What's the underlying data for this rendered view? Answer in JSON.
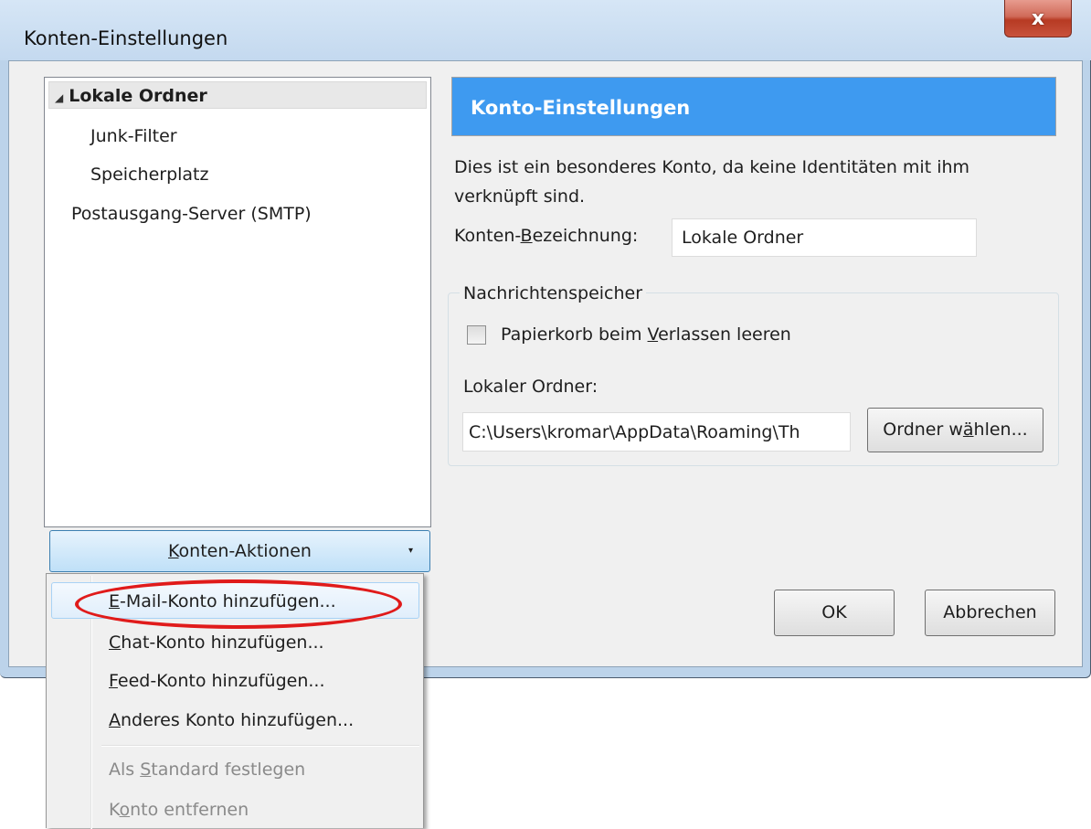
{
  "window": {
    "title": "Konten-Einstellungen",
    "close_symbol": "x"
  },
  "tree": {
    "items": [
      {
        "label": "Lokale Ordner",
        "expander": "◢"
      },
      {
        "label": "Junk-Filter"
      },
      {
        "label": "Speicherplatz"
      },
      {
        "label": "Postausgang-Server (SMTP)"
      }
    ]
  },
  "account_actions": {
    "button": {
      "before": "",
      "accel": "K",
      "after": "onten-Aktionen",
      "drop_symbol": "▾"
    },
    "menu": {
      "items": [
        {
          "accel": "E",
          "after": "-Mail-Konto hinzufügen...",
          "before": ""
        },
        {
          "accel": "C",
          "after": "hat-Konto hinzufügen...",
          "before": ""
        },
        {
          "accel": "F",
          "after": "eed-Konto hinzufügen...",
          "before": ""
        },
        {
          "accel": "A",
          "after": "nderes Konto hinzufügen...",
          "before": ""
        },
        {
          "before": "Als ",
          "accel": "S",
          "after": "tandard festlegen"
        },
        {
          "before": "K",
          "accel": "o",
          "after": "nto entfernen"
        }
      ]
    },
    "highlight_color": "#e01b1b"
  },
  "panel": {
    "header": "Konto-Einstellungen",
    "header_color": "#3e9af0",
    "description": "Dies ist ein besonderes Konto, da keine Identitäten mit ihm verknüpft sind.",
    "name_label": {
      "before": "Konten-",
      "accel": "B",
      "after": "ezeichnung:"
    },
    "name_value": "Lokale Ordner",
    "storage": {
      "legend": "Nachrichtenspeicher",
      "empty_trash": {
        "before": "Papierkorb beim ",
        "accel": "V",
        "after": "erlassen leeren",
        "checked": false
      },
      "local_folder_label": "Lokaler Ordner:",
      "local_folder_value": "C:\\Users\\kromar\\AppData\\Roaming\\Th",
      "choose_button": {
        "before": "Ordner w",
        "accel": "ä",
        "after": "hlen..."
      }
    }
  },
  "footer": {
    "ok": "OK",
    "cancel": "Abbrechen"
  }
}
